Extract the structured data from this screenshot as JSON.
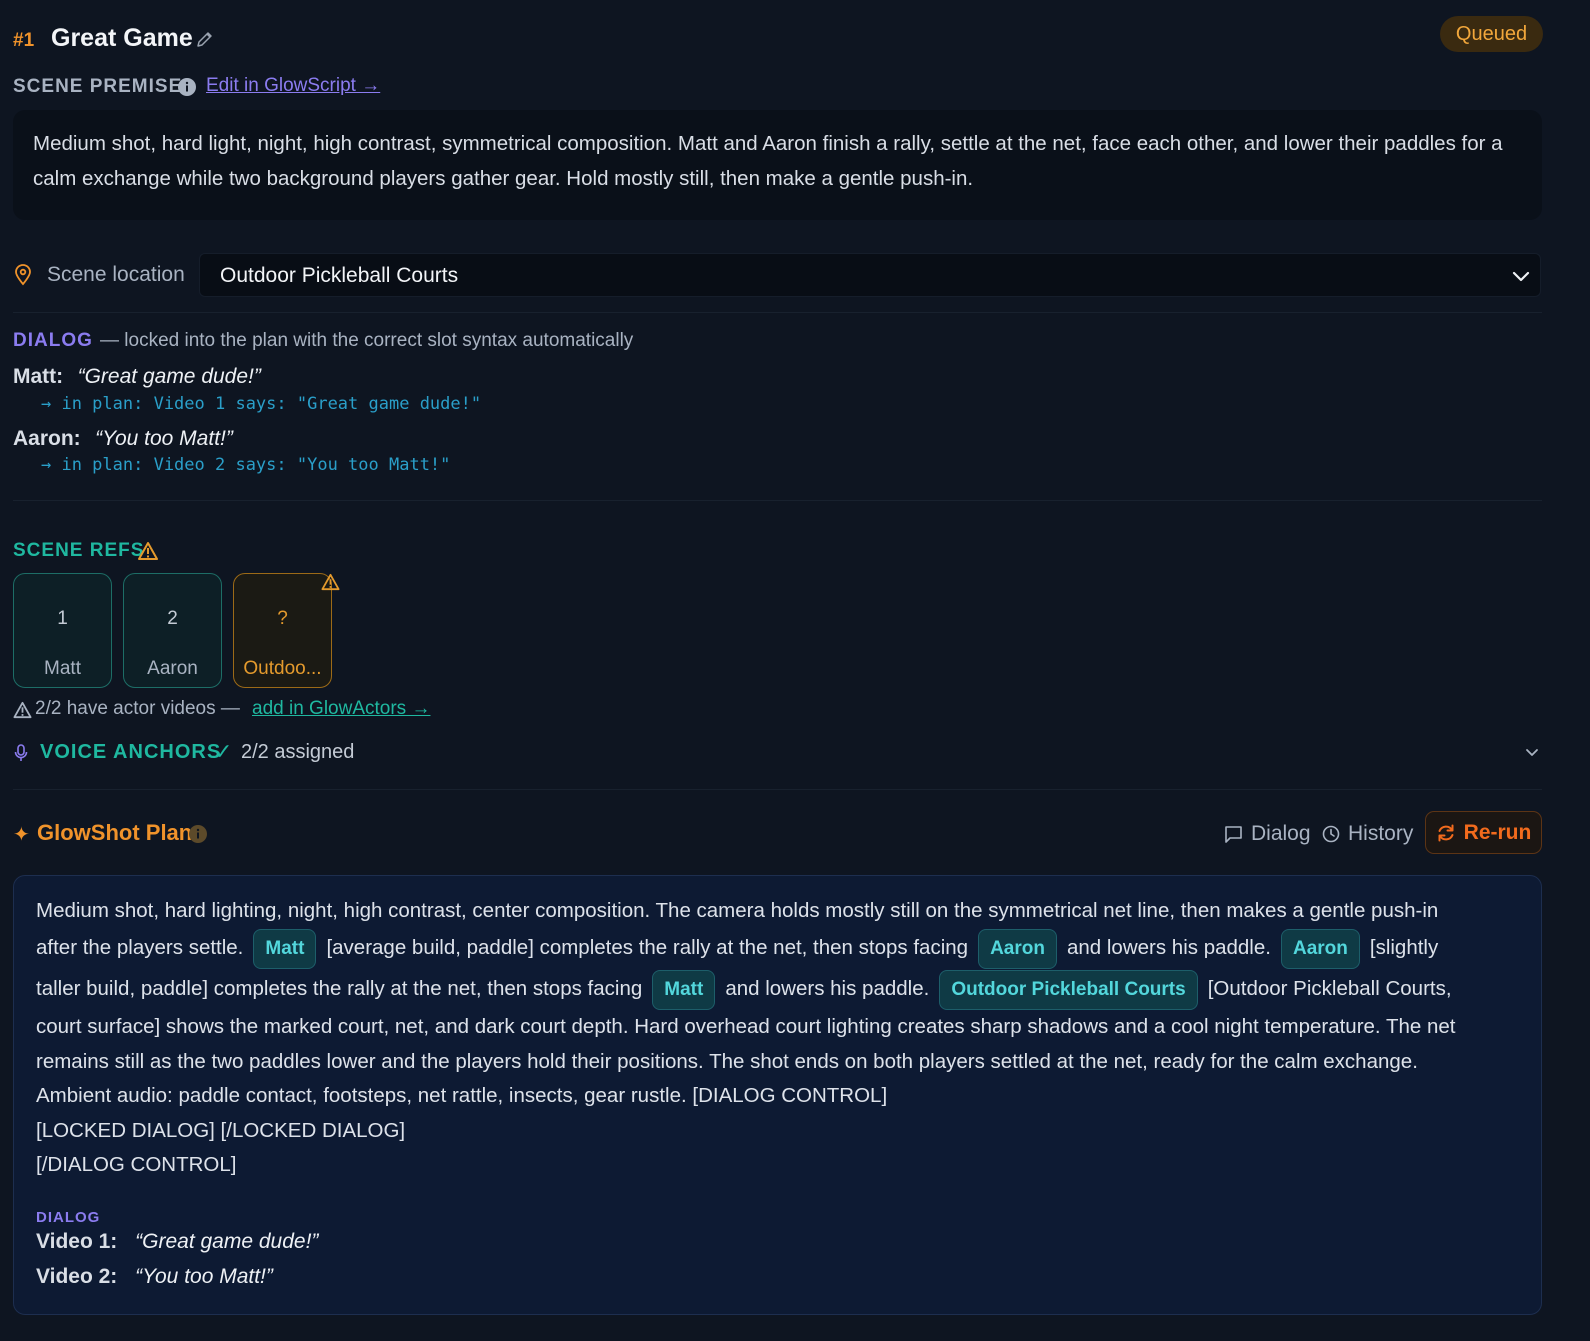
{
  "header": {
    "scene_number": "#1",
    "title": "Great Game",
    "status": "Queued"
  },
  "premise": {
    "label": "SCENE PREMISE",
    "edit_link": "Edit in GlowScript →",
    "text": "Medium shot, hard light, night, high contrast, symmetrical composition. Matt and Aaron finish a rally, settle at the net, face each other, and lower their paddles for a calm exchange while two background players gather gear. Hold mostly still, then make a gentle push-in."
  },
  "location": {
    "label": "Scene location",
    "value": "Outdoor Pickleball Courts"
  },
  "dialog": {
    "label": "DIALOG",
    "description": "— locked into the plan with the correct slot syntax automatically",
    "lines": [
      {
        "speaker": "Matt:",
        "quote": "“Great game dude!”",
        "plan": "→ in plan: Video 1 says: \"Great game dude!\""
      },
      {
        "speaker": "Aaron:",
        "quote": "“You too Matt!”",
        "plan": "→ in plan: Video 2 says: \"You too Matt!\""
      }
    ]
  },
  "refs": {
    "label": "SCENE REFS",
    "cards": [
      {
        "num": "1",
        "name": "Matt"
      },
      {
        "num": "2",
        "name": "Aaron"
      },
      {
        "num": "?",
        "name": "Outdoo..."
      }
    ],
    "actors_text": "2/2 have actor videos —",
    "actors_link": "add in GlowActors →"
  },
  "voice": {
    "label": "VOICE ANCHORS",
    "check": "✓",
    "status": "2/2 assigned"
  },
  "plan": {
    "title": "GlowShot Plan",
    "dialog_button": "Dialog",
    "history_button": "History",
    "rerun_button": "Re-run",
    "line1": "Medium shot, hard lighting, night, high contrast, center composition. The camera holds mostly still on the symmetrical net line, then makes a gentle push-in",
    "l2_a": "after the players settle.",
    "chip_matt": "Matt",
    "l2_b": "[average build, paddle] completes the rally at the net, then stops facing",
    "chip_aaron": "Aaron",
    "l2_c": "and lowers his paddle.",
    "l2_d": "[slightly",
    "l3_a": "taller build, paddle] completes the rally at the net, then stops facing",
    "l3_b": "and lowers his paddle.",
    "chip_location": "Outdoor Pickleball Courts",
    "l3_c": "[Outdoor Pickleball Courts,",
    "line4": "court surface] shows the marked court, net, and dark court depth. Hard overhead court lighting creates sharp shadows and a cool night temperature. The net",
    "line5": "remains still as the two paddles lower and the players hold their positions. The shot ends on both players settled at the net, ready for the calm exchange.",
    "line6": "Ambient audio: paddle contact, footsteps, net rattle, insects, gear rustle. [DIALOG CONTROL]",
    "line7": "[LOCKED DIALOG] [/LOCKED DIALOG]",
    "line8": "[/DIALOG CONTROL]",
    "dialog_label": "DIALOG",
    "dialog_lines": [
      {
        "speaker": "Video 1:",
        "quote": "“Great game dude!”"
      },
      {
        "speaker": "Video 2:",
        "quote": "“You too Matt!”"
      }
    ]
  },
  "colors": {
    "background": "#0e1521",
    "accent_orange": "#f0932b",
    "accent_teal": "#1fb8a0",
    "accent_purple": "#8b7cf0",
    "chip_text": "#53d7dc"
  }
}
